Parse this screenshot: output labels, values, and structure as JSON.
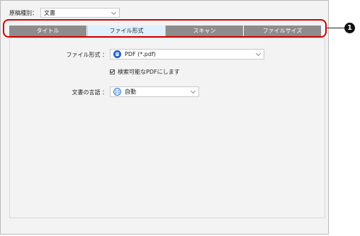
{
  "doc_type": {
    "label": "原稿種別：",
    "value": "文書"
  },
  "tabs": [
    {
      "label": "タイトル"
    },
    {
      "label": "ファイル形式"
    },
    {
      "label": "スキャン"
    },
    {
      "label": "ファイルサイズ"
    }
  ],
  "active_tab": 1,
  "format": {
    "label": "ファイル形式 ：",
    "value": "PDF (*.pdf)",
    "searchable_label": "検索可能なPDFにします",
    "searchable_checked": true
  },
  "language": {
    "label": "文書の言語 ：",
    "value": "自動"
  },
  "callout": "1",
  "colors": {
    "callout_border": "#d10000",
    "active_tab": "#dff0ff",
    "inactive_tab": "#8c8c8c"
  }
}
